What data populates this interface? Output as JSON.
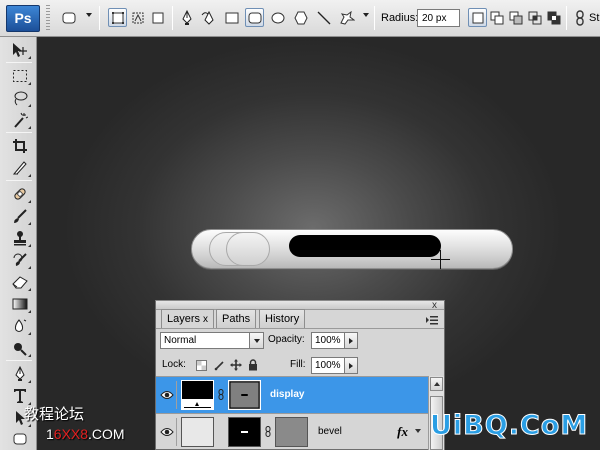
{
  "app": {
    "logo": "Ps"
  },
  "options_bar": {
    "radius_label": "Radius:",
    "radius_value": "20 px",
    "style_label": "St"
  },
  "layers_panel": {
    "tabs": [
      {
        "label": "Layers",
        "active": true,
        "closable": true
      },
      {
        "label": "Paths",
        "active": false
      },
      {
        "label": "History",
        "active": false
      }
    ],
    "close_glyph": "x",
    "blend_mode": "Normal",
    "opacity_label": "Opacity:",
    "opacity_value": "100%",
    "lock_label": "Lock:",
    "fill_label": "Fill:",
    "fill_value": "100%",
    "layers": [
      {
        "name": "display",
        "selected": true,
        "visible": true,
        "has_fx": false
      },
      {
        "name": "bevel",
        "selected": false,
        "visible": true,
        "has_fx": true,
        "fx_label": "fx"
      }
    ]
  },
  "watermark": {
    "left_line1": "教程论坛",
    "left_line2_pre": "1",
    "left_line2_red": "6XX8",
    "left_line2_post": ".COM",
    "right": "UiBQ.CoM"
  },
  "colors": {
    "layer_selected": "#3c96e8",
    "ps_logo": "#1c4f98",
    "watermark_blue": "#2a9ee4",
    "watermark_red": "#e31f1f"
  }
}
